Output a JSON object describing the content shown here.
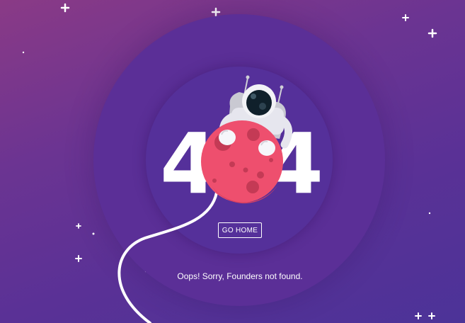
{
  "error": {
    "digit_left": "4",
    "digit_right": "4"
  },
  "actions": {
    "home_label": "GO HOME"
  },
  "message": "Oops! Sorry, Founders not found.",
  "colors": {
    "background_top": "#8a3a86",
    "background_bottom": "#4c3398",
    "ring_outer": "#5b2f97",
    "ring_inner": "#55309a",
    "planet": "#ee4f6e",
    "planet_crater": "#c43a55",
    "text": "#ffffff"
  },
  "icons": [
    "astronaut-icon",
    "planet-icon",
    "star-icon"
  ]
}
